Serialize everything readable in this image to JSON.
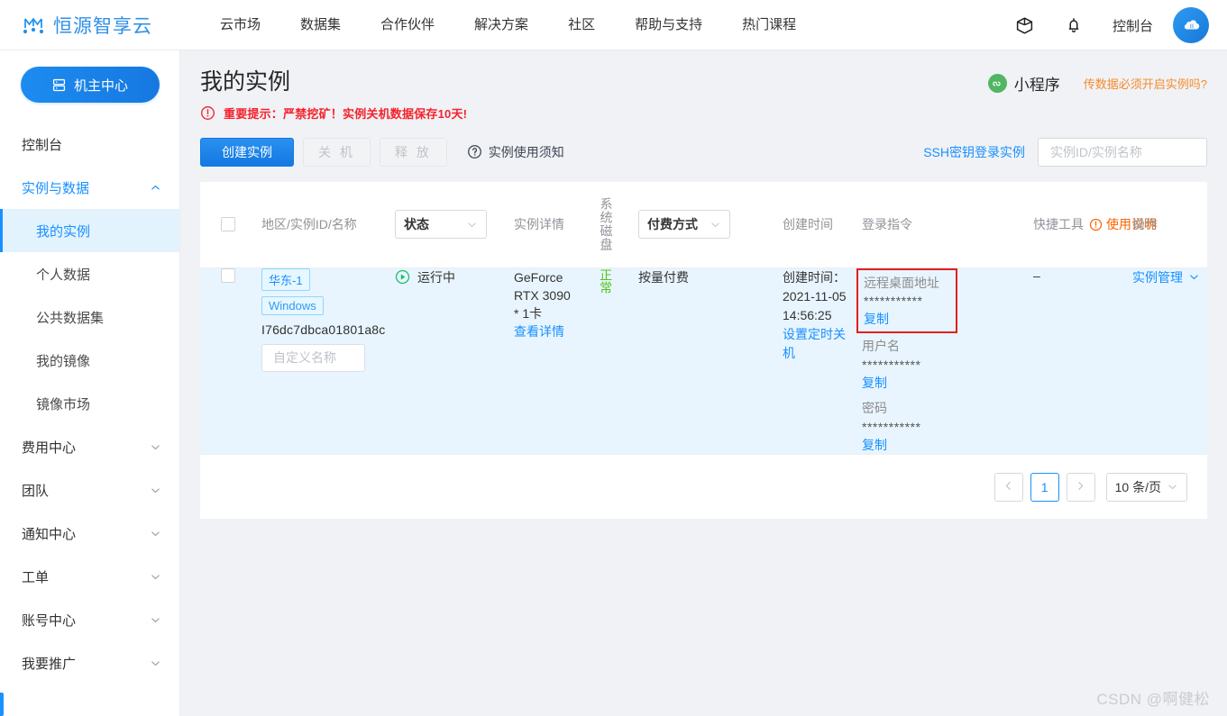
{
  "topnav": {
    "brand": "恒源智享云",
    "logo_icon": "network-m-logo-icon",
    "items": [
      "云市场",
      "数据集",
      "合作伙伴",
      "解决方案",
      "社区",
      "帮助与支持",
      "热门课程"
    ],
    "cube_icon": "cube-icon",
    "bell_icon": "bell-icon",
    "console": "控制台",
    "avatar_icon": "cloud-avatar-icon"
  },
  "sidebar": {
    "owner_button": "机主中心",
    "owner_icon": "server-icon",
    "groups": [
      {
        "label": "控制台",
        "expandable": false
      },
      {
        "label": "实例与数据",
        "expandable": true,
        "expanded": true,
        "active": true,
        "items": [
          "我的实例",
          "个人数据",
          "公共数据集",
          "我的镜像",
          "镜像市场"
        ],
        "selected": "我的实例"
      },
      {
        "label": "费用中心",
        "expandable": true,
        "expanded": false
      },
      {
        "label": "团队",
        "expandable": true,
        "expanded": false
      },
      {
        "label": "通知中心",
        "expandable": true,
        "expanded": false
      },
      {
        "label": "工单",
        "expandable": true,
        "expanded": false
      },
      {
        "label": "账号中心",
        "expandable": true,
        "expanded": false
      },
      {
        "label": "我要推广",
        "expandable": true,
        "expanded": false
      }
    ]
  },
  "page": {
    "title": "我的实例",
    "warning_icon": "alert-circle-icon",
    "warning": "重要提示：严禁挖矿！实例关机数据保存10天!",
    "mini_app_label": "小程序",
    "mini_app_icon": "miniapp-icon",
    "data_question_link": "传数据必须开启实例吗?"
  },
  "toolbar": {
    "create": "创建实例",
    "shutdown": "关 机",
    "release": "释 放",
    "notice": "实例使用须知",
    "notice_icon": "question-circle-icon",
    "ssh_link": "SSH密钥登录实例",
    "search_placeholder": "实例ID/实例名称",
    "search_value": ""
  },
  "table": {
    "headers": {
      "region": "地区/实例ID/名称",
      "state_filter": "状态",
      "detail": "实例详情",
      "disk": "系统磁盘",
      "pay_filter": "付费方式",
      "create_time": "创建时间",
      "login_cmd": "登录指令",
      "tools": "快捷工具",
      "tools_usage": "使用说明",
      "tools_warn_icon": "alert-circle-small-icon",
      "action": "操作"
    },
    "rows": [
      {
        "checked": false,
        "region_tag": "华东-1",
        "os_tag": "Windows",
        "instance_id": "I76dc7dbca01801a8c",
        "name_placeholder": "自定义名称",
        "name_value": "",
        "state": "运行中",
        "state_icon": "play-circle-icon",
        "gpu": "GeForce RTX 3090 * 1卡",
        "detail_link": "查看详情",
        "disk_status": "正常",
        "pay_mode": "按量付费",
        "create_time_label": "创建时间：",
        "create_time_value": "2021-11-05 14:56:25",
        "timer_link": "设置定时关机",
        "login": [
          {
            "label": "远程桌面地址",
            "value": "***********",
            "copy": "复制",
            "highlighted": true
          },
          {
            "label": "用户名",
            "value": "***********",
            "copy": "复制",
            "highlighted": false
          },
          {
            "label": "密码",
            "value": "***********",
            "copy": "复制",
            "highlighted": false
          }
        ],
        "tools": "–",
        "action": "实例管理",
        "action_icon": "chevron-down-icon"
      }
    ]
  },
  "pagination": {
    "prev_icon": "chevron-left-icon",
    "page": "1",
    "next_icon": "chevron-right-icon",
    "page_size": "10 条/页",
    "page_size_icon": "chevron-down-icon"
  },
  "watermark": "CSDN @啊健松",
  "colors": {
    "brand_blue": "#2f8fe8",
    "primary": "#1890ff",
    "danger_red": "#f5222d",
    "warn_orange": "#fa6400",
    "success_green": "#52c41a",
    "highlight_box": "#e02020",
    "row_bg": "#e8f5fe"
  }
}
